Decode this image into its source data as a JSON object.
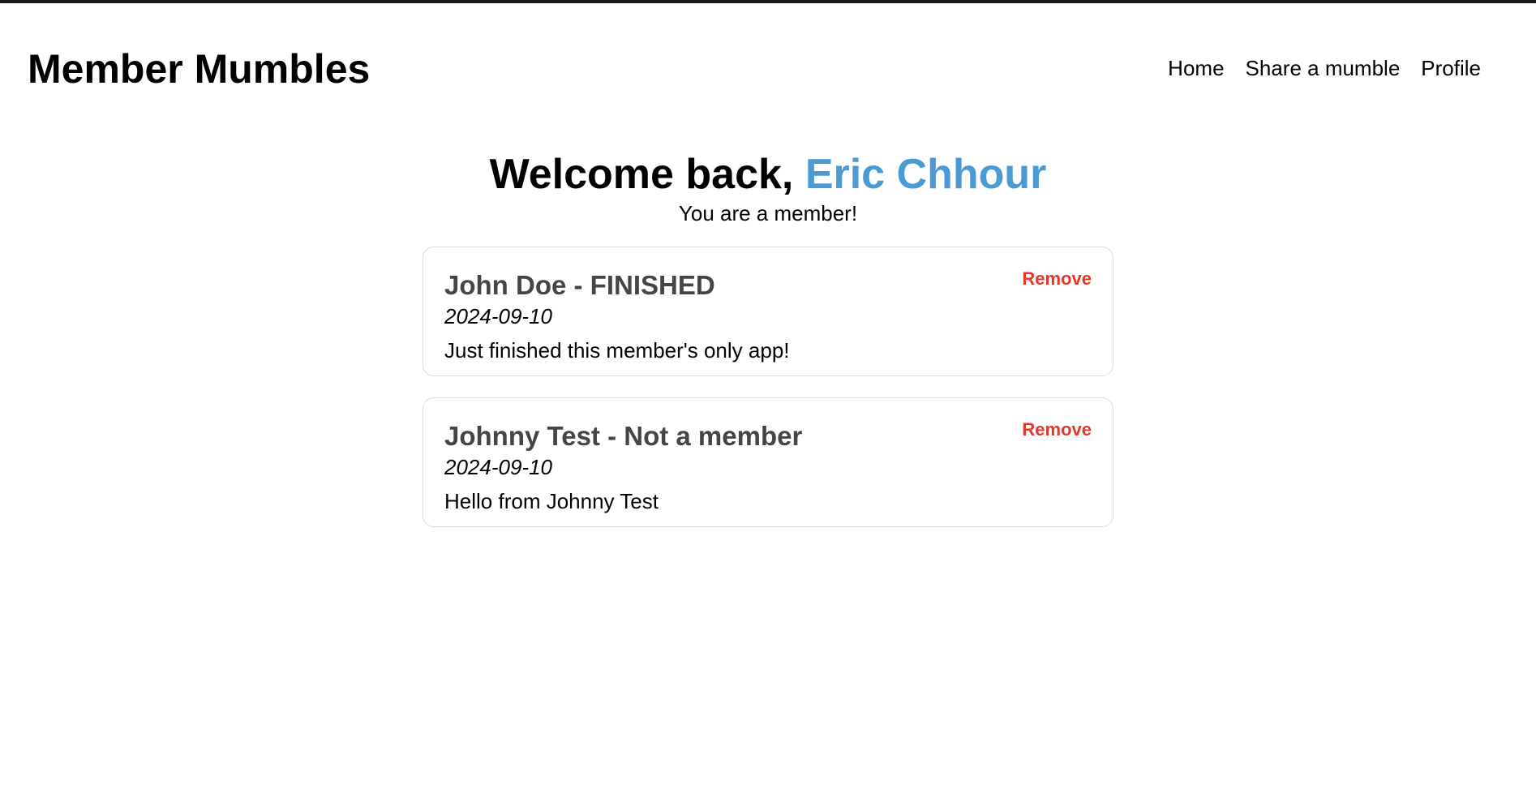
{
  "header": {
    "site_title": "Member Mumbles",
    "nav": [
      {
        "label": "Home"
      },
      {
        "label": "Share a mumble"
      },
      {
        "label": "Profile"
      }
    ]
  },
  "welcome": {
    "greeting": "Welcome back, ",
    "user_name": "Eric Chhour",
    "status": "You are a member!"
  },
  "messages": [
    {
      "title": "John Doe - FINISHED",
      "date": "2024-09-10",
      "body": "Just finished this member's only app!",
      "remove_label": "Remove"
    },
    {
      "title": "Johnny Test - Not a member",
      "date": "2024-09-10",
      "body": "Hello from Johnny Test",
      "remove_label": "Remove"
    }
  ],
  "colors": {
    "accent": "#4a9ad4",
    "danger": "#e0392c",
    "card_title": "#454545",
    "card_border": "#dcdcdc"
  }
}
